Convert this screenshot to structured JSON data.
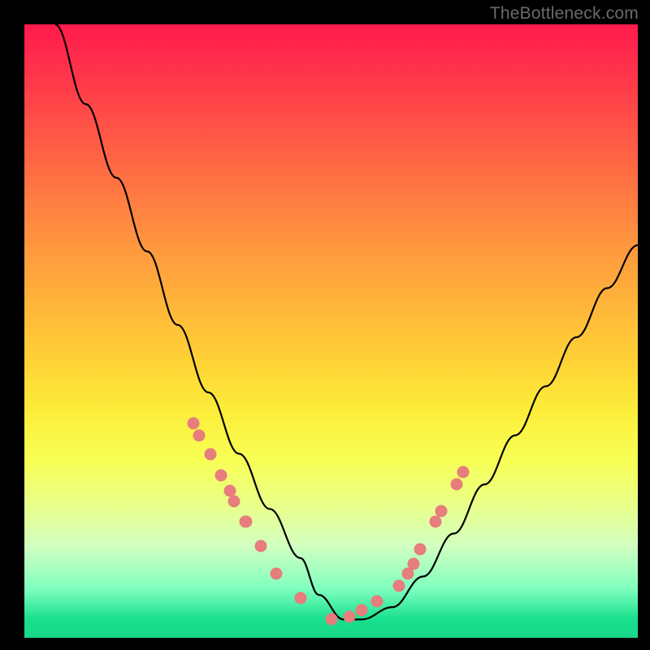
{
  "watermark": "TheBottleneck.com",
  "chart_data": {
    "type": "line",
    "title": "",
    "xlabel": "",
    "ylabel": "",
    "xlim": [
      0,
      100
    ],
    "ylim": [
      0,
      100
    ],
    "series": [
      {
        "name": "curve",
        "x": [
          5,
          10,
          15,
          20,
          25,
          30,
          35,
          40,
          45,
          48,
          52,
          55,
          60,
          65,
          70,
          75,
          80,
          85,
          90,
          95,
          100
        ],
        "y": [
          100,
          87,
          75,
          63,
          51,
          40,
          30,
          21,
          13,
          7,
          3,
          3,
          5,
          10,
          17,
          25,
          33,
          41,
          49,
          57,
          64
        ]
      }
    ],
    "dots_left": {
      "x": [
        27.5,
        28.5,
        30.3,
        32.0,
        33.5,
        34.2,
        36.0,
        36.2,
        38.5,
        41.0,
        45.0
      ],
      "y": [
        35,
        33,
        30,
        26.5,
        24,
        22.3,
        19,
        19,
        15,
        10.5,
        6.5
      ]
    },
    "dots_right": {
      "x": [
        50,
        53,
        55,
        57.5,
        61,
        62.5,
        63.5,
        64.5,
        67,
        68,
        70.5,
        71.5
      ],
      "y": [
        3,
        3.5,
        4.5,
        6,
        8.5,
        10.5,
        12,
        14.5,
        19,
        20.7,
        25,
        27
      ]
    },
    "gradient_stops": [
      {
        "pos": 0,
        "color": "#ff1a4d"
      },
      {
        "pos": 50,
        "color": "#ffd236"
      },
      {
        "pos": 100,
        "color": "#18d888"
      }
    ]
  }
}
